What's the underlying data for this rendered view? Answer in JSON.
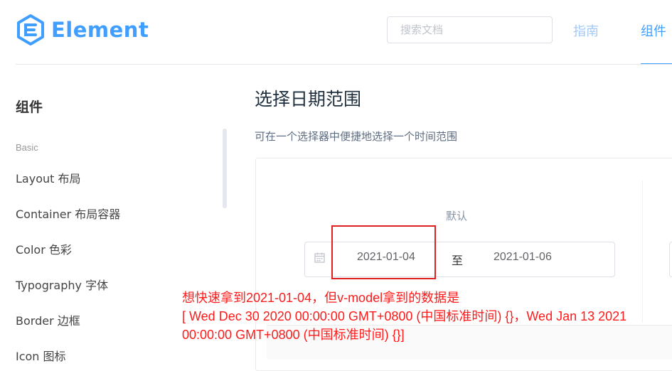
{
  "header": {
    "logo_text": "Element",
    "search_placeholder": "搜索文档",
    "nav": {
      "guide": "指南",
      "components": "组件"
    },
    "accent": "#409EFF"
  },
  "sidebar": {
    "title": "组件",
    "group": "Basic",
    "items": [
      {
        "label": "Layout 布局"
      },
      {
        "label": "Container 布局容器"
      },
      {
        "label": "Color 色彩"
      },
      {
        "label": "Typography 字体"
      },
      {
        "label": "Border 边框"
      },
      {
        "label": "Icon 图标"
      }
    ]
  },
  "main": {
    "title": "选择日期范围",
    "description": "可在一个选择器中便捷地选择一个时间范围",
    "demo": {
      "label": "默认",
      "range": {
        "start": "2021-01-04",
        "separator": "至",
        "end": "2021-01-06"
      },
      "icon": "calendar-icon"
    }
  },
  "annotation": {
    "line1": "想快速拿到2021-01-04，但v-model拿到的数据是",
    "line2": "[ Wed Dec 30 2020 00:00:00 GMT+0800 (中国标准时间) {}，Wed Jan 13 2021 00:00:00 GMT+0800 (中国标准时间) {}]",
    "color": "#ff1a1a"
  }
}
